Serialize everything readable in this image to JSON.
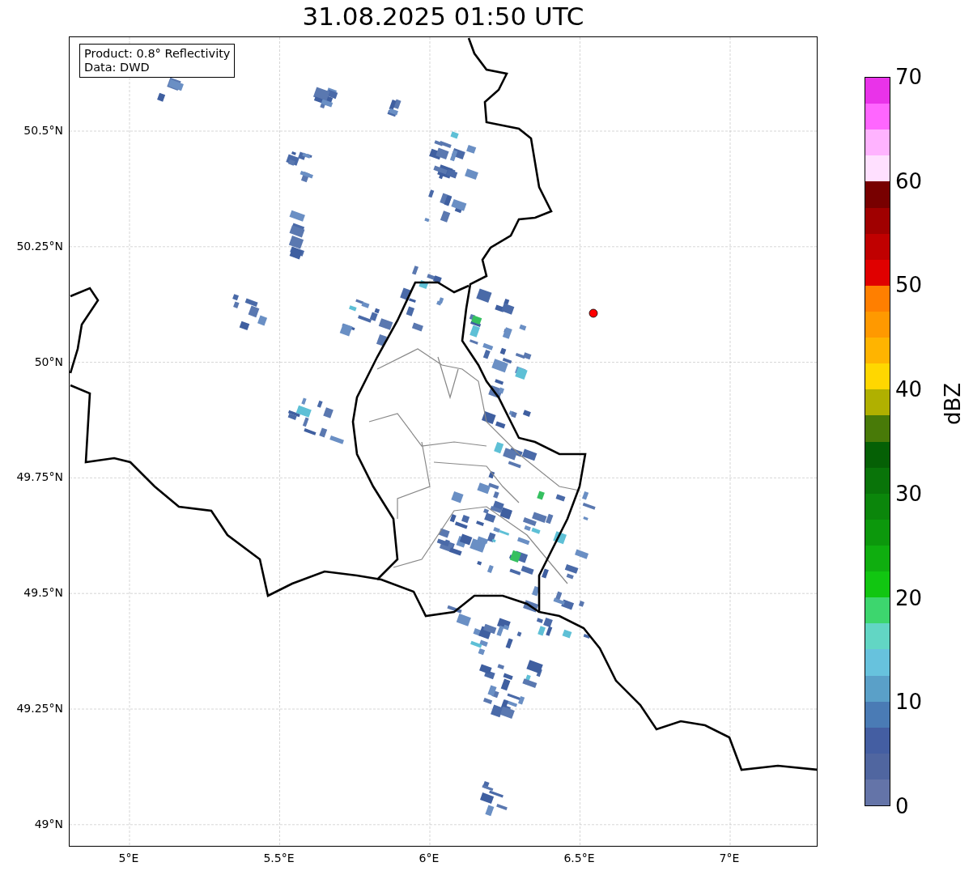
{
  "title": "31.08.2025 01:50 UTC",
  "info_box": {
    "lines": [
      "Product: 0.8° Reflectivity",
      "Data: DWD"
    ]
  },
  "map": {
    "lat_ticks": [
      "50.5°N",
      "50.25°N",
      "50°N",
      "49.75°N",
      "49.5°N",
      "49.25°N",
      "49°N"
    ],
    "lon_ticks": [
      "5°E",
      "5.5°E",
      "6°E",
      "6.5°E",
      "7°E"
    ]
  },
  "colorbar": {
    "label": "dBZ",
    "ticks": [
      "70",
      "60",
      "50",
      "40",
      "30",
      "20",
      "10",
      "0"
    ],
    "segments": [
      {
        "color": "#e933e9"
      },
      {
        "color": "#ff66ff"
      },
      {
        "color": "#ffb3ff"
      },
      {
        "color": "#ffe0ff"
      },
      {
        "color": "#780000"
      },
      {
        "color": "#a00000"
      },
      {
        "color": "#c00000"
      },
      {
        "color": "#e00000"
      },
      {
        "color": "#ff7f00"
      },
      {
        "color": "#ff9900"
      },
      {
        "color": "#ffb400"
      },
      {
        "color": "#ffd700"
      },
      {
        "color": "#b0b000"
      },
      {
        "color": "#487a08"
      },
      {
        "color": "#056005"
      },
      {
        "color": "#097409"
      },
      {
        "color": "#0b860b"
      },
      {
        "color": "#0c980c"
      },
      {
        "color": "#0fae0f"
      },
      {
        "color": "#11c611"
      },
      {
        "color": "#3dd66e"
      },
      {
        "color": "#62d6c4"
      },
      {
        "color": "#67c2dd"
      },
      {
        "color": "#5aa0c8"
      },
      {
        "color": "#4a7bb5"
      },
      {
        "color": "#445ea2"
      },
      {
        "color": "#5066a0"
      },
      {
        "color": "#6474a8"
      }
    ]
  }
}
